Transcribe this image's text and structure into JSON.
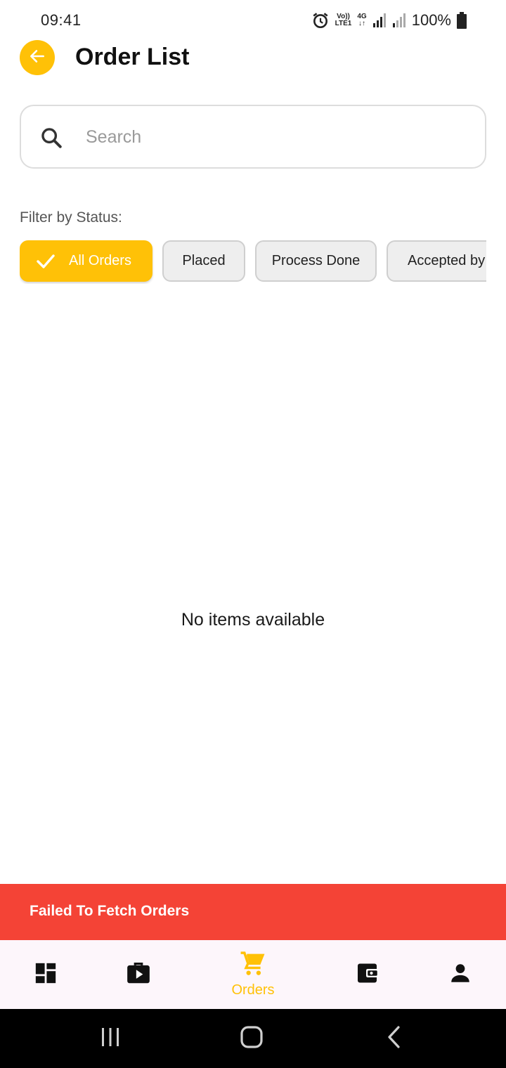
{
  "status_bar": {
    "time": "09:41",
    "net_top": "Vo))",
    "net_bottom": "LTE1",
    "net_type": "4G",
    "battery": "100%"
  },
  "header": {
    "title": "Order List",
    "back_icon": "arrow-left-icon"
  },
  "search": {
    "placeholder": "Search",
    "value": ""
  },
  "filter": {
    "label": "Filter by Status:",
    "chips": [
      "All Orders",
      "Placed",
      "Process Done",
      "Accepted by"
    ],
    "selected": "All Orders"
  },
  "main": {
    "empty_message": "No items available"
  },
  "snackbar": {
    "message": "Failed To Fetch Orders"
  },
  "bottom_nav": {
    "items": [
      {
        "icon": "dashboard-icon",
        "label": ""
      },
      {
        "icon": "work-play-icon",
        "label": ""
      },
      {
        "icon": "cart-icon",
        "label": "Orders"
      },
      {
        "icon": "wallet-icon",
        "label": ""
      },
      {
        "icon": "person-icon",
        "label": ""
      }
    ],
    "active_index": 2
  },
  "colors": {
    "accent": "#FFC107",
    "error": "#F44336",
    "chip_bg": "#EEEEEE",
    "nav_bg": "#FDF6FB"
  }
}
